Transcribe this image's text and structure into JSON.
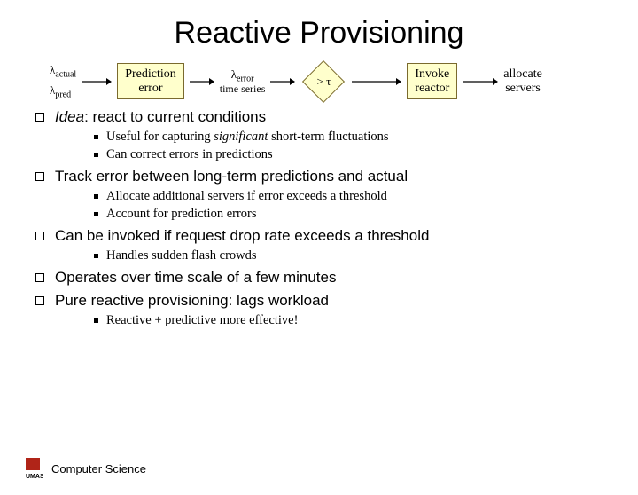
{
  "title": "Reactive Provisioning",
  "diagram": {
    "input1_sub": "actual",
    "input2_sub": "pred",
    "box1_line1": "Prediction",
    "box1_line2": "error",
    "mid_label_sub": "error",
    "mid_label_line2": "time series",
    "diamond_text": "> τ",
    "box2_line1": "Invoke",
    "box2_line2": "reactor",
    "out_line1": "allocate",
    "out_line2": "servers"
  },
  "bullets": {
    "b1_prefix": "Idea",
    "b1_rest": ": react to current conditions",
    "b1_s1_a": "Useful for capturing ",
    "b1_s1_b": "significant",
    "b1_s1_c": " short-term fluctuations",
    "b1_s2": "Can correct errors in predictions",
    "b2": "Track error between long-term predictions and actual",
    "b2_s1": "Allocate additional servers if error exceeds a threshold",
    "b2_s2": "Account for prediction errors",
    "b3": "Can be invoked if request drop rate exceeds a threshold",
    "b3_s1": "Handles sudden flash crowds",
    "b4": "Operates over time scale of a few minutes",
    "b5": "Pure reactive provisioning: lags workload",
    "b5_s1": "Reactive + predictive more effective!"
  },
  "footer": "Computer Science"
}
